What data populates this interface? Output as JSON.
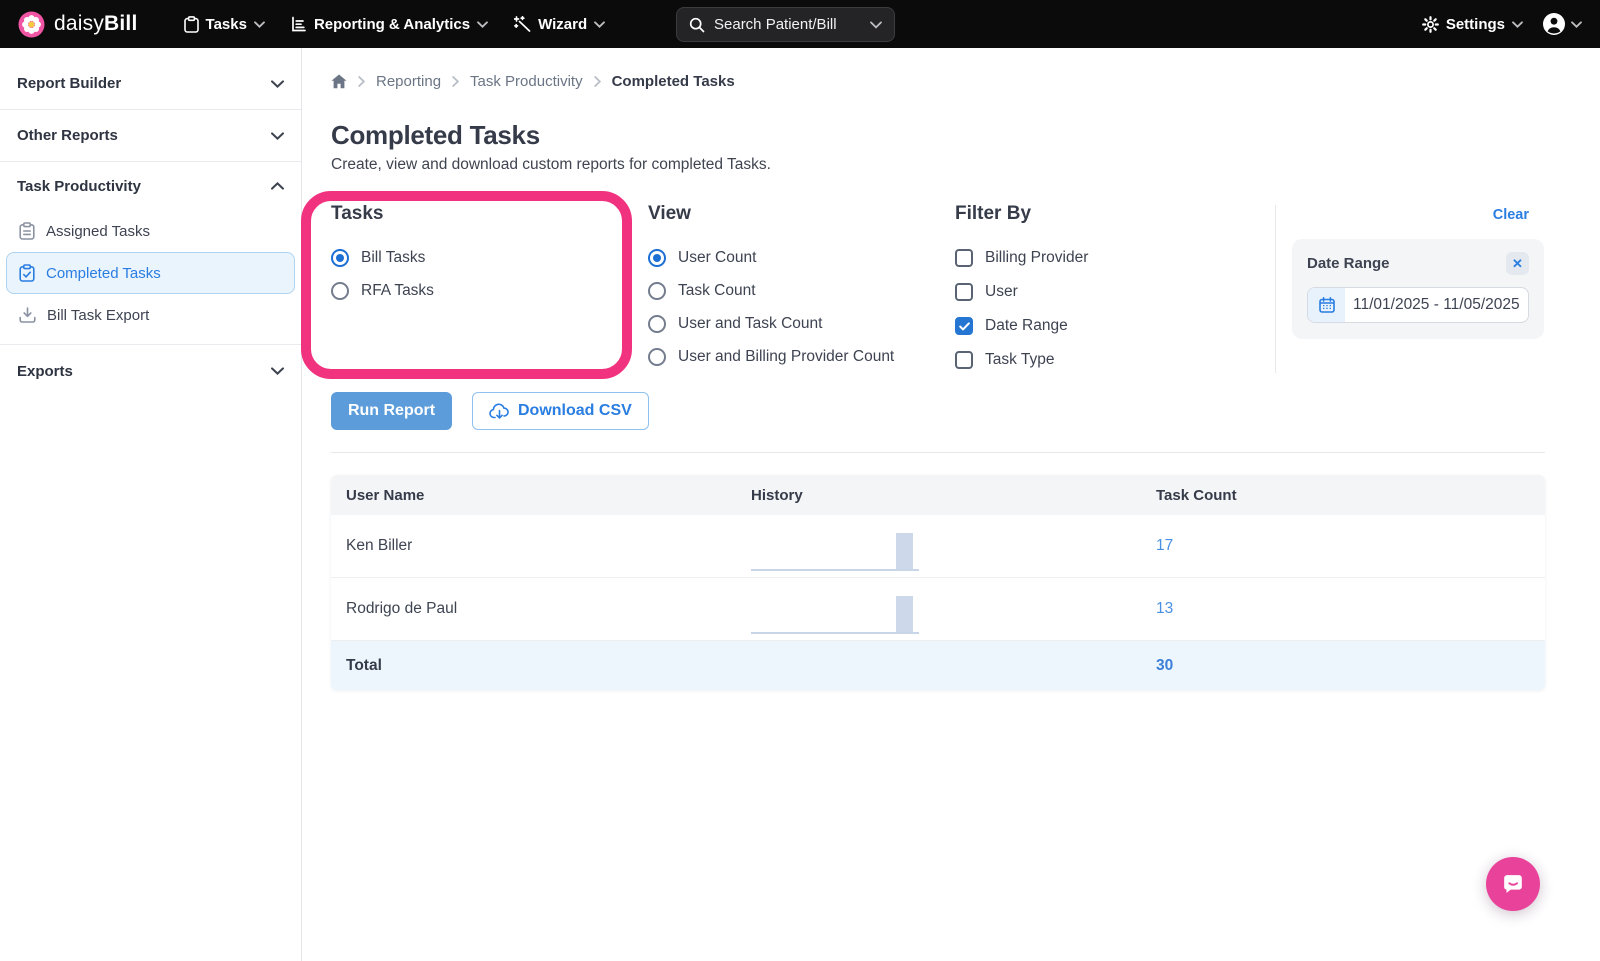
{
  "navbar": {
    "brand_daisy": "daisy",
    "brand_bill": "Bill",
    "menu_tasks": "Tasks",
    "menu_reporting": "Reporting & Analytics",
    "menu_wizard": "Wizard",
    "search_placeholder": "Search Patient/Bill",
    "settings_label": "Settings"
  },
  "sidebar": {
    "report_builder": "Report Builder",
    "other_reports": "Other Reports",
    "task_productivity": "Task Productivity",
    "exports": "Exports",
    "items": [
      {
        "label": "Assigned Tasks",
        "active": false
      },
      {
        "label": "Completed Tasks",
        "active": true
      },
      {
        "label": "Bill Task Export",
        "active": false
      }
    ]
  },
  "breadcrumb": {
    "reporting": "Reporting",
    "task_productivity": "Task Productivity",
    "current": "Completed Tasks"
  },
  "page": {
    "title": "Completed Tasks",
    "subtitle": "Create, view and download custom reports for completed Tasks."
  },
  "tasks_section": {
    "title": "Tasks",
    "options": [
      {
        "label": "Bill Tasks",
        "selected": true
      },
      {
        "label": "RFA Tasks",
        "selected": false
      }
    ]
  },
  "view_section": {
    "title": "View",
    "options": [
      {
        "label": "User Count",
        "selected": true
      },
      {
        "label": "Task Count",
        "selected": false
      },
      {
        "label": "User and Task Count",
        "selected": false
      },
      {
        "label": "User and Billing Provider Count",
        "selected": false
      }
    ]
  },
  "filter_section": {
    "title": "Filter By",
    "options": [
      {
        "label": "Billing Provider",
        "checked": false
      },
      {
        "label": "User",
        "checked": false
      },
      {
        "label": "Date Range",
        "checked": true
      },
      {
        "label": "Task Type",
        "checked": false
      }
    ]
  },
  "filter_panel": {
    "clear": "Clear",
    "date_range_label": "Date Range",
    "date_range_value": "11/01/2025 - 11/05/2025",
    "close": "✕"
  },
  "actions": {
    "run_report": "Run Report",
    "download_csv": "Download CSV"
  },
  "results_table": {
    "columns": {
      "user": "User Name",
      "history": "History",
      "count": "Task Count"
    },
    "rows": [
      {
        "user": "Ken Biller",
        "count": "17"
      },
      {
        "user": "Rodrigo de Paul",
        "count": "13"
      }
    ],
    "total_label": "Total",
    "total_count": "30"
  },
  "colors": {
    "accent_blue": "#2a7de1",
    "run_button_blue": "#5c9cda",
    "count_link_blue": "#4a90e2",
    "annotation_pink": "#f1337f",
    "chat_pink": "#e9429a",
    "sparkline_bar": "#cdd9ea",
    "total_row_bg": "#edf6fd",
    "navbar_black": "#0b0b0c",
    "active_item_bg": "#e9f4fd"
  }
}
